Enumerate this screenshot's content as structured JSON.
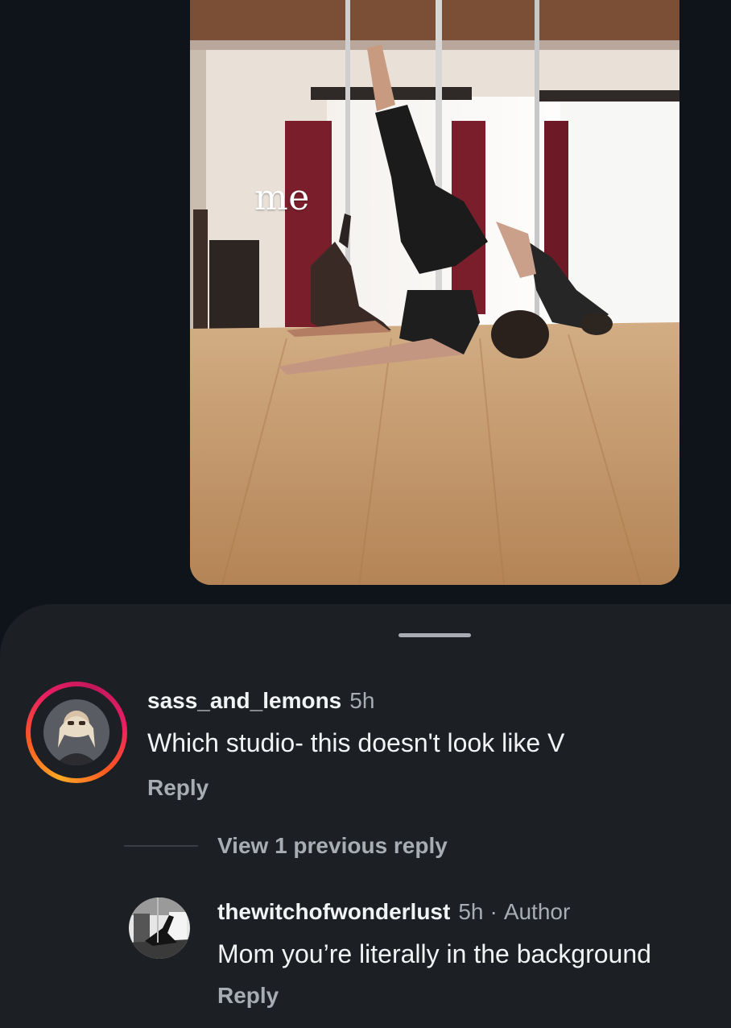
{
  "post": {
    "overlay_caption": "me",
    "image_description_icon": "dance-studio-photo"
  },
  "sheet": {
    "handle_icon": "drag-handle"
  },
  "comments": [
    {
      "username": "sass_and_lemons",
      "time": "5h",
      "text": "Which studio- this doesn't look like V",
      "reply_label": "Reply",
      "avatar_icon": "user-avatar-story-ring"
    }
  ],
  "view_replies_label": "View 1 previous reply",
  "replies": [
    {
      "username": "thewitchofwonderlust",
      "time": "5h",
      "separator": "·",
      "badge": "Author",
      "text": "Mom you’re literally in the background",
      "reply_label": "Reply",
      "avatar_icon": "user-avatar"
    }
  ],
  "colors": {
    "background": "#0f141b",
    "sheet": "#1c1f24",
    "primary_text": "#f1f3f4",
    "secondary_text": "#a8adb4",
    "story_ring_start": "#f9a825",
    "story_ring_end": "#e91e63"
  }
}
